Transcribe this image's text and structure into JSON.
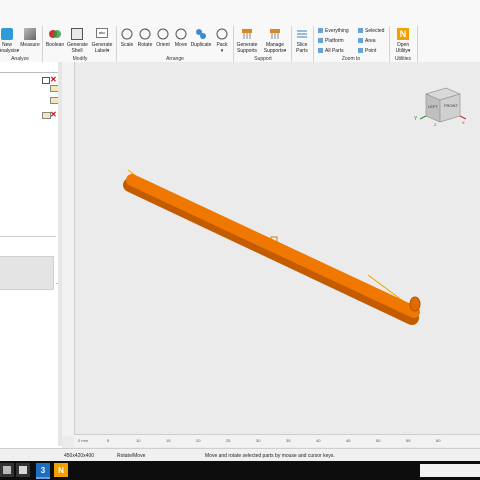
{
  "ribbon": {
    "buttons": [
      {
        "id": "new-analysis",
        "label": "New\nAnalysis▾"
      },
      {
        "id": "measure",
        "label": "Measure"
      },
      {
        "id": "boolean",
        "label": "Boolean"
      },
      {
        "id": "generate-shell",
        "label": "Generate\nShell"
      },
      {
        "id": "generate-label",
        "label": "Generate\nLabel▾"
      },
      {
        "id": "scale",
        "label": "Scale"
      },
      {
        "id": "rotate",
        "label": "Rotate"
      },
      {
        "id": "orient",
        "label": "Orient"
      },
      {
        "id": "move",
        "label": "Move"
      },
      {
        "id": "duplicate",
        "label": "Duplicate"
      },
      {
        "id": "pack",
        "label": "Pack\n▾"
      },
      {
        "id": "generate-supports",
        "label": "Generate\nSupports"
      },
      {
        "id": "manage-supports",
        "label": "Manage\nSupports▾"
      },
      {
        "id": "slice-parts",
        "label": "Slice\nParts"
      },
      {
        "id": "open-utility",
        "label": "Open\nUtility▾"
      }
    ],
    "groups": {
      "analyze": "Analyze",
      "modify": "Modify",
      "arrange": "Arrange",
      "support": "Support",
      "zoom_to": "Zoom to",
      "utilities": "Utilities"
    },
    "zoom_items": {
      "everything": "Everything",
      "platform": "Platform",
      "all_parts": "All Parts",
      "selected": "Selected",
      "area": "Area",
      "point": "Point"
    }
  },
  "viewcube": {
    "left": "LEFT",
    "front": "FRONT",
    "axis_y": "Y",
    "axis_z": "Z",
    "axis_x": "X"
  },
  "ruler": {
    "unit": "0 mm",
    "h_ticks": [
      "5",
      "10",
      "15",
      "20",
      "25",
      "30",
      "35",
      "40",
      "45",
      "50",
      "55",
      "60"
    ]
  },
  "status": {
    "dimensions": "450x420x400",
    "mode": "Rotate/Move",
    "hint": "Move and rotate selected parts by mouse and cursor keys."
  },
  "taskbar": {
    "app3_label": "3",
    "app4_label": "N"
  },
  "colors": {
    "part": "#f07800",
    "part_edge": "#c35c00",
    "accent": "#f2a100",
    "selection": "#e07b00"
  }
}
